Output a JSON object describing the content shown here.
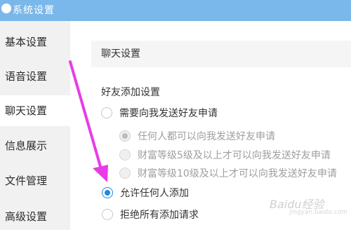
{
  "window": {
    "title": "系统设置",
    "accent_color": "#7ab7ea"
  },
  "sidebar": {
    "items": [
      {
        "label": "基本设置",
        "active": false
      },
      {
        "label": "语音设置",
        "active": false
      },
      {
        "label": "聊天设置",
        "active": true
      },
      {
        "label": "信息展示",
        "active": false
      },
      {
        "label": "文件管理",
        "active": false
      },
      {
        "label": "高级设置",
        "active": false
      }
    ]
  },
  "main": {
    "section_title": "聊天设置",
    "friend_add": {
      "label": "好友添加设置",
      "options": [
        {
          "label": "需要向我发送好友申请",
          "checked": false,
          "enabled": true
        },
        {
          "label": "任何人都可以向我发送好友申请",
          "checked": true,
          "enabled": false
        },
        {
          "label": "财富等级5级及以上才可以向我发送好友申请",
          "checked": false,
          "enabled": false
        },
        {
          "label": "财富等级10级及以上才可以向我发送好友申请",
          "checked": false,
          "enabled": false
        },
        {
          "label": "允许任何人添加",
          "checked": true,
          "enabled": true
        },
        {
          "label": "拒绝所有添加请求",
          "checked": false,
          "enabled": true
        }
      ]
    }
  },
  "annotation": {
    "arrow_color": "#e83ce6"
  },
  "watermark": {
    "text": "Baidu经验",
    "sub": "jingyan.baidu.com"
  }
}
